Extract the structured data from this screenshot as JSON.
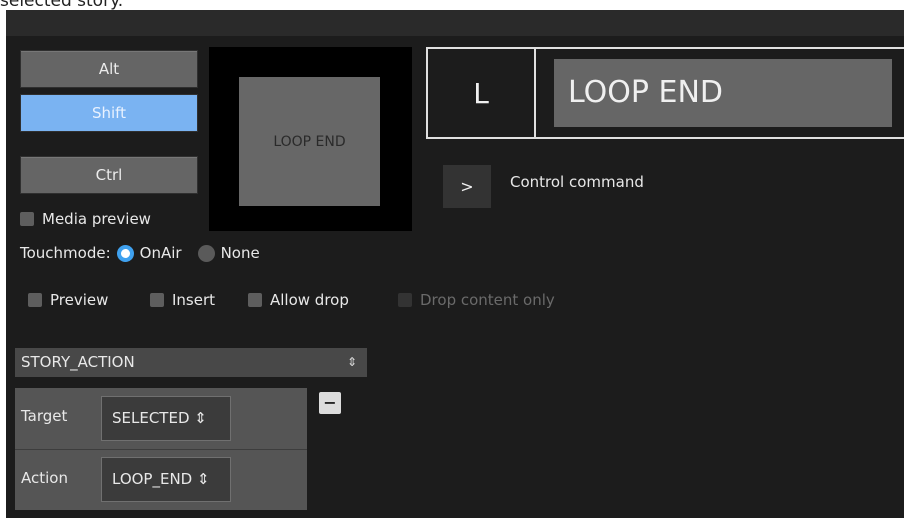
{
  "caption": "selected story.",
  "modifiers": {
    "alt": "Alt",
    "shift": "Shift",
    "ctrl": "Ctrl"
  },
  "media_preview_label": "Media preview",
  "preview_tile_text": "LOOP END",
  "touchmode": {
    "label": "Touchmode:",
    "option_onair": "OnAir",
    "option_none": "None",
    "selected": "OnAir"
  },
  "options": {
    "preview": "Preview",
    "insert": "Insert",
    "allow_drop": "Allow drop",
    "drop_content_only": "Drop content only"
  },
  "shortcut": {
    "key": "L",
    "name": "LOOP END"
  },
  "command": {
    "button": ">",
    "label": "Control command"
  },
  "action_type": {
    "value": "STORY_ACTION",
    "arrows": "⇕"
  },
  "params": [
    {
      "label": "Target",
      "value": "SELECTED ⇕"
    },
    {
      "label": "Action",
      "value": "LOOP_END ⇕"
    }
  ],
  "remove_button": "−",
  "colors": {
    "accent": "#7ab3f2",
    "radio": "#3fa1ef",
    "panel_bg": "#1c1c1c"
  }
}
